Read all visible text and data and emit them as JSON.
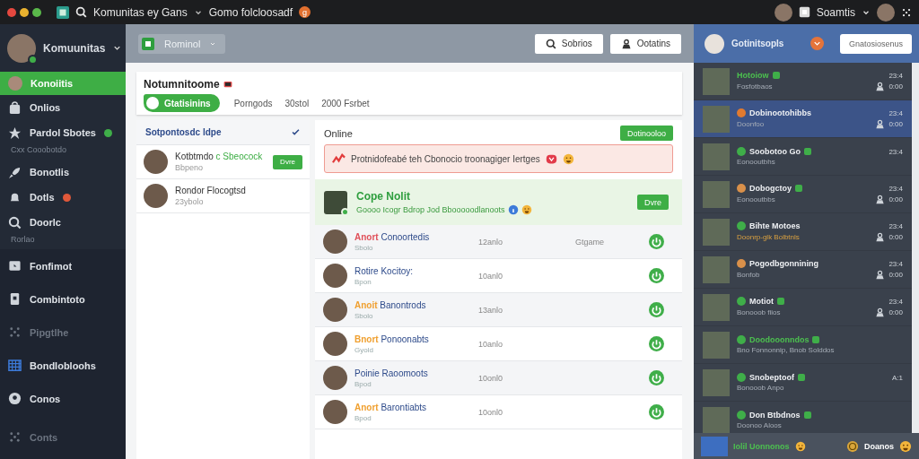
{
  "titlebar": {
    "app": "Komunitas ey Gans",
    "channel": "Gomo folcloosadf",
    "channel_badge": "g",
    "user": "Soamtis"
  },
  "sidebar": {
    "user": "Komuunitas",
    "items": [
      {
        "label": "Konoiitis",
        "selected": true,
        "disabled": false
      },
      {
        "label": "Onlios",
        "selected": false,
        "disabled": false
      },
      {
        "label": "Pardol Sbotes",
        "selected": false,
        "disabled": false,
        "color": "#3fae49",
        "sub": "Cxx Cooobotdo"
      },
      {
        "label": "Bonotlis",
        "selected": false,
        "disabled": false
      },
      {
        "label": "Dotls",
        "selected": false,
        "disabled": false,
        "color": "#e0583a"
      },
      {
        "label": "Doorlc",
        "selected": false,
        "disabled": false,
        "sub": "Rorlao"
      },
      {
        "label": "Fonfimot",
        "selected": false,
        "disabled": false
      },
      {
        "label": "Combintoto",
        "selected": false,
        "disabled": false
      },
      {
        "label": "Pipgtlhe",
        "selected": false,
        "disabled": true
      },
      {
        "label": "Bondlobloohs",
        "selected": false,
        "disabled": false
      },
      {
        "label": "Conos",
        "selected": false,
        "disabled": false
      },
      {
        "label": "Conts",
        "selected": false,
        "disabled": true
      }
    ]
  },
  "header": {
    "workspace": "Rominol",
    "buttons": [
      "Sobrios",
      "Ootatins"
    ]
  },
  "card": {
    "title": "Notumnitoome",
    "tabs": [
      {
        "label": "Gtatisinins",
        "selected": true
      },
      {
        "label": "Porngods",
        "selected": false
      },
      {
        "label": "30stol",
        "selected": false
      },
      {
        "label": "2000 Fsrbet",
        "selected": false
      }
    ]
  },
  "requests": {
    "title": "Sotpontosdc ldpe",
    "items": [
      {
        "name": "Kotbtmdo",
        "tag": "c Sbeocock",
        "sub": "Bbpeno",
        "action": "Dvre"
      },
      {
        "name": "Rondor Flocogtsd",
        "sub": "23ybolo"
      }
    ]
  },
  "online": {
    "title": "Online",
    "button": "Dotinooloo",
    "alert": "Protnidofeabé teh Cbonocio troonagiger Iertges",
    "featured": {
      "name": "Cope Nolit",
      "sub": "Goooo Icogr Bdrop Jod Bbooooodlanoots",
      "action": "Dvre"
    },
    "rows": [
      {
        "prefix": "Anort",
        "color": "#e0505a",
        "name": "Conoortedis",
        "sub": "Sbolo",
        "time": "12anlo",
        "extra": "Gtgame"
      },
      {
        "name": "Rotire Kocitoy:",
        "sub": "Bpon",
        "time": "10anl0"
      },
      {
        "prefix": "Anoit",
        "color": "#f0a030",
        "name": "Banontrods",
        "sub": "Sbolo",
        "time": "13anlo"
      },
      {
        "prefix": "Bnort",
        "color": "#f0a030",
        "name": "Ponoonabts",
        "sub": "Gyold",
        "time": "10anlo"
      },
      {
        "name": "Poinie Raoomoots",
        "sub": "Bpod",
        "time": "10onl0"
      },
      {
        "prefix": "Anort",
        "color": "#f0a030",
        "name": "Barontiabts",
        "sub": "Bpod",
        "time": "10onl0"
      }
    ]
  },
  "chat": {
    "user": "Gotinitsopls",
    "button": "Gnatosiosenus",
    "items": [
      {
        "kind": "live",
        "name": "Hotoiow",
        "sub": "Fosfotbaos",
        "time": "23:4",
        "meta": "0:00",
        "selected": false,
        "badge": true
      },
      {
        "kind": "normal",
        "name": "Dobinootohibbs",
        "color": "#e07a30",
        "sub": "Doonfoo",
        "time": "23:4",
        "meta": "0:00",
        "selected": true,
        "badge": false
      },
      {
        "kind": "normal",
        "name": "Soobotoo Go",
        "color": "#3fae49",
        "sub": "Eonooutbhs",
        "time": "23:4",
        "selected": false,
        "badge": true
      },
      {
        "kind": "normal",
        "name": "Dobogctoy",
        "color": "#d9904a",
        "sub": "Eonooutbbs",
        "time": "23:4",
        "meta": "0:00",
        "selected": false,
        "badge": true
      },
      {
        "kind": "warn",
        "name": "Bihte Motoes",
        "color": "#3fae49",
        "sub": "Doonrp-glk Bolbtnls",
        "time": "23:4",
        "meta": "0:00",
        "selected": false,
        "badge": false
      },
      {
        "kind": "normal",
        "name": "Pogodbgonnining",
        "color": "#d9904a",
        "sub": "Bonfob",
        "time": "23:4",
        "meta": "0:00",
        "selected": false,
        "badge": false
      },
      {
        "kind": "normal",
        "name": "Motiot",
        "color": "#3fae49",
        "sub": "Bonooob fiios",
        "time": "23:4",
        "meta": "0:00",
        "selected": false,
        "badge": true
      },
      {
        "kind": "live",
        "name": "Doodooonndos",
        "color": "#3fae49",
        "sub": "Bno Fonnonnip, Bnob Solddos",
        "selected": false,
        "badge": true
      },
      {
        "kind": "normal",
        "name": "Snobeptoof",
        "color": "#3fae49",
        "sub": "Bonooob Anpo",
        "time": "A:1",
        "selected": false,
        "badge": true
      },
      {
        "kind": "normal",
        "name": "Don Btbdnos",
        "color": "#3fae49",
        "sub": "Doonoo Aloos",
        "selected": false,
        "badge": true
      }
    ],
    "footer": {
      "name": "Iolil Uonnonos",
      "balance": "Doanos"
    }
  }
}
